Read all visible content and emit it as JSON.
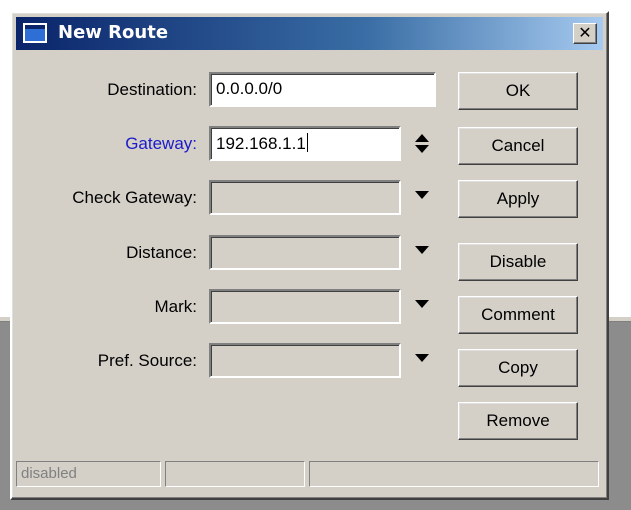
{
  "window": {
    "title": "New Route",
    "close_glyph": "✕"
  },
  "form": {
    "destination": {
      "label": "Destination:",
      "value": "0.0.0.0/0"
    },
    "gateway": {
      "label": "Gateway:",
      "value": "192.168.1.1"
    },
    "check_gateway": {
      "label": "Check Gateway:",
      "value": ""
    },
    "distance": {
      "label": "Distance:",
      "value": ""
    },
    "mark": {
      "label": "Mark:",
      "value": ""
    },
    "pref_source": {
      "label": "Pref. Source:",
      "value": ""
    }
  },
  "buttons": {
    "ok": "OK",
    "cancel": "Cancel",
    "apply": "Apply",
    "disable": "Disable",
    "comment": "Comment",
    "copy": "Copy",
    "remove": "Remove"
  },
  "statusbar": [
    "disabled",
    "",
    ""
  ],
  "colors": {
    "title_start": "#0a246a",
    "title_end": "#a6caf0",
    "link_label": "#1a1acc",
    "face": "#d4d0c8"
  }
}
